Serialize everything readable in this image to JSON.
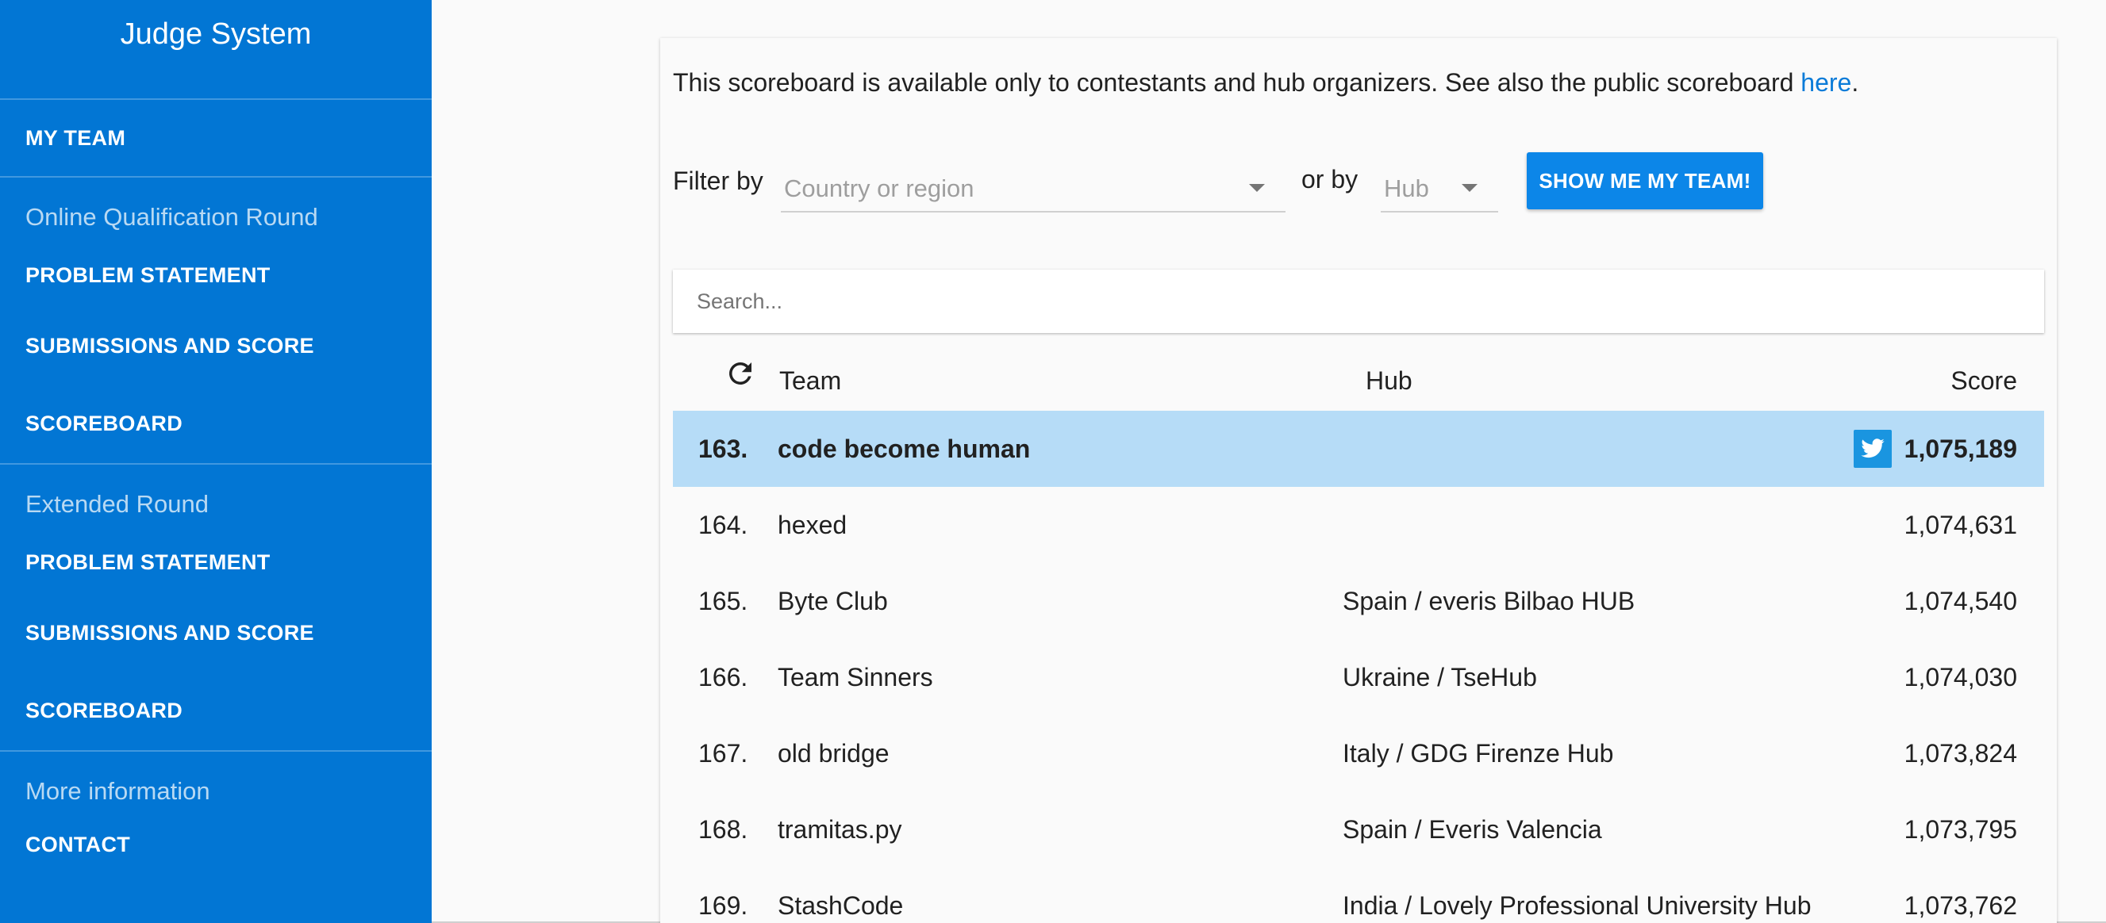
{
  "sidebar": {
    "title": "Judge System",
    "my_team": "MY TEAM",
    "groups": [
      {
        "header": "Online Qualification Round",
        "links": [
          "PROBLEM STATEMENT",
          "SUBMISSIONS AND SCORE",
          "SCOREBOARD"
        ]
      },
      {
        "header": "Extended Round",
        "links": [
          "PROBLEM STATEMENT",
          "SUBMISSIONS AND SCORE",
          "SCOREBOARD"
        ]
      },
      {
        "header": "More information",
        "links": [
          "CONTACT"
        ]
      }
    ]
  },
  "notice": {
    "text": "This scoreboard is available only to contestants and hub organizers. See also the public scoreboard ",
    "link": "here",
    "suffix": "."
  },
  "filters": {
    "label": "Filter by",
    "country_placeholder": "Country or region",
    "or_by": "or by",
    "hub_placeholder": "Hub",
    "button": "SHOW ME MY TEAM!"
  },
  "search": {
    "placeholder": "Search..."
  },
  "table": {
    "headers": {
      "team": "Team",
      "hub": "Hub",
      "score": "Score"
    },
    "rows": [
      {
        "rank": "163.",
        "team": "code become human",
        "hub": "",
        "score": "1,075,189",
        "highlight": true,
        "icon": "twitter-icon"
      },
      {
        "rank": "164.",
        "team": "hexed",
        "hub": "",
        "score": "1,074,631"
      },
      {
        "rank": "165.",
        "team": "Byte Club",
        "hub": "Spain / everis Bilbao HUB",
        "score": "1,074,540"
      },
      {
        "rank": "166.",
        "team": "Team Sinners",
        "hub": "Ukraine / TseHub",
        "score": "1,074,030"
      },
      {
        "rank": "167.",
        "team": "old bridge",
        "hub": "Italy / GDG Firenze Hub",
        "score": "1,073,824"
      },
      {
        "rank": "168.",
        "team": "tramitas.py",
        "hub": "Spain / Everis Valencia",
        "score": "1,073,795"
      },
      {
        "rank": "169.",
        "team": "StashCode",
        "hub": "India / Lovely Professional University Hub",
        "score": "1,073,762"
      }
    ]
  },
  "colors": {
    "sidebar_bg": "#0276d4",
    "accent": "#0c86e8",
    "highlight_row": "#b6dcf7",
    "twitter": "#1a95e0"
  }
}
